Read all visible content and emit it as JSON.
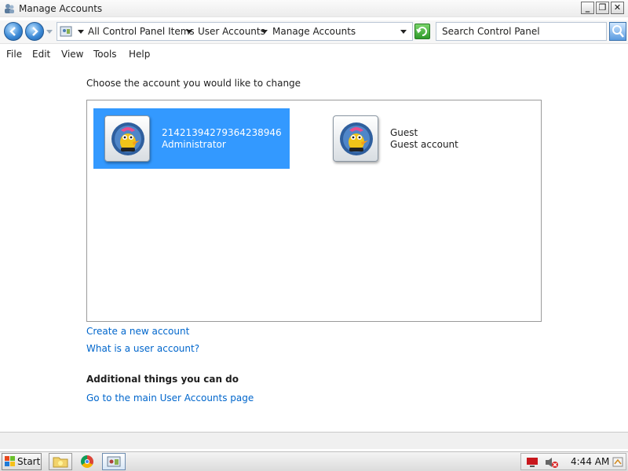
{
  "window": {
    "title": "Manage Accounts",
    "controls": {
      "minimize": "_",
      "restore": "❐",
      "close": "✕"
    }
  },
  "address": {
    "breadcrumbs": [
      "All Control Panel Items",
      "User Accounts",
      "Manage Accounts"
    ],
    "search_placeholder": "Search Control Panel"
  },
  "menu": [
    "File",
    "Edit",
    "View",
    "Tools",
    "Help"
  ],
  "main": {
    "heading": "Choose the account you would like to change",
    "accounts": [
      {
        "name": "2142139427936423894​6",
        "type": "Administrator",
        "selected": true
      },
      {
        "name": "Guest",
        "type": "Guest account",
        "selected": false
      }
    ],
    "links": [
      "Create a new account",
      "What is a user account?"
    ],
    "additional_title": "Additional things you can do",
    "additional_links": [
      "Go to the main User Accounts page"
    ]
  },
  "taskbar": {
    "start_label": "Start",
    "clock": "4:44 AM"
  },
  "icons": {
    "back": "back-arrow-icon",
    "forward": "forward-arrow-icon",
    "refresh": "refresh-icon",
    "search": "search-icon"
  }
}
